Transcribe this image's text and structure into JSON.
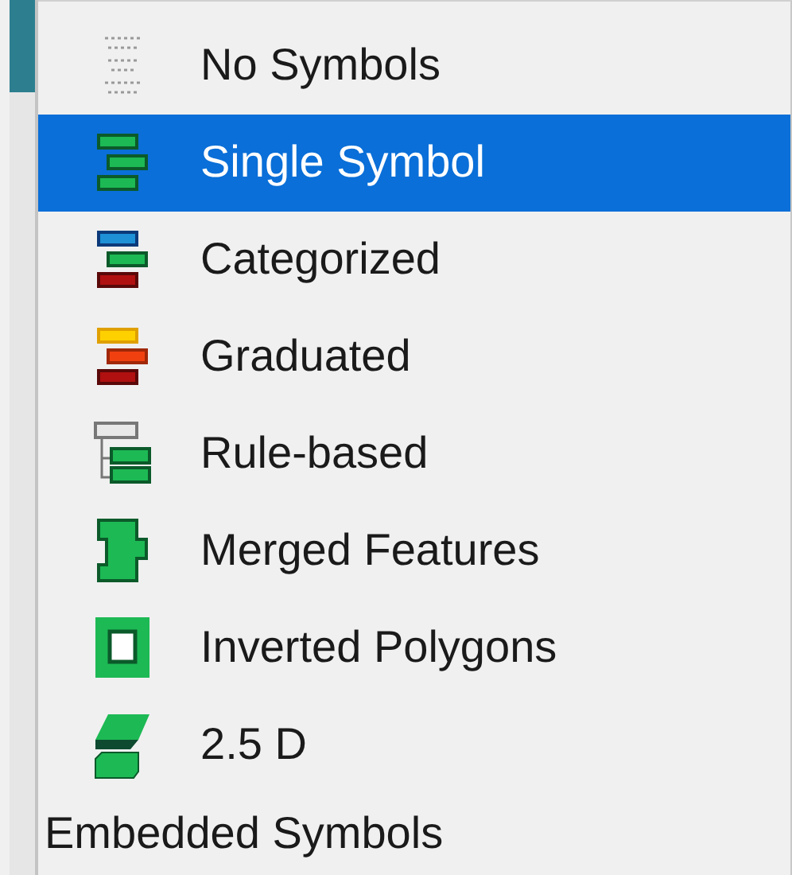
{
  "menu": {
    "items": [
      {
        "label": "No Symbols",
        "selected": false,
        "kind": "renderer"
      },
      {
        "label": "Single Symbol",
        "selected": true,
        "kind": "renderer"
      },
      {
        "label": "Categorized",
        "selected": false,
        "kind": "renderer"
      },
      {
        "label": "Graduated",
        "selected": false,
        "kind": "renderer"
      },
      {
        "label": "Rule-based",
        "selected": false,
        "kind": "renderer"
      },
      {
        "label": "Merged Features",
        "selected": false,
        "kind": "renderer"
      },
      {
        "label": "Inverted Polygons",
        "selected": false,
        "kind": "renderer"
      },
      {
        "label": "2.5 D",
        "selected": false,
        "kind": "renderer"
      },
      {
        "label": "Embedded Symbols",
        "selected": false,
        "kind": "plain"
      }
    ]
  }
}
